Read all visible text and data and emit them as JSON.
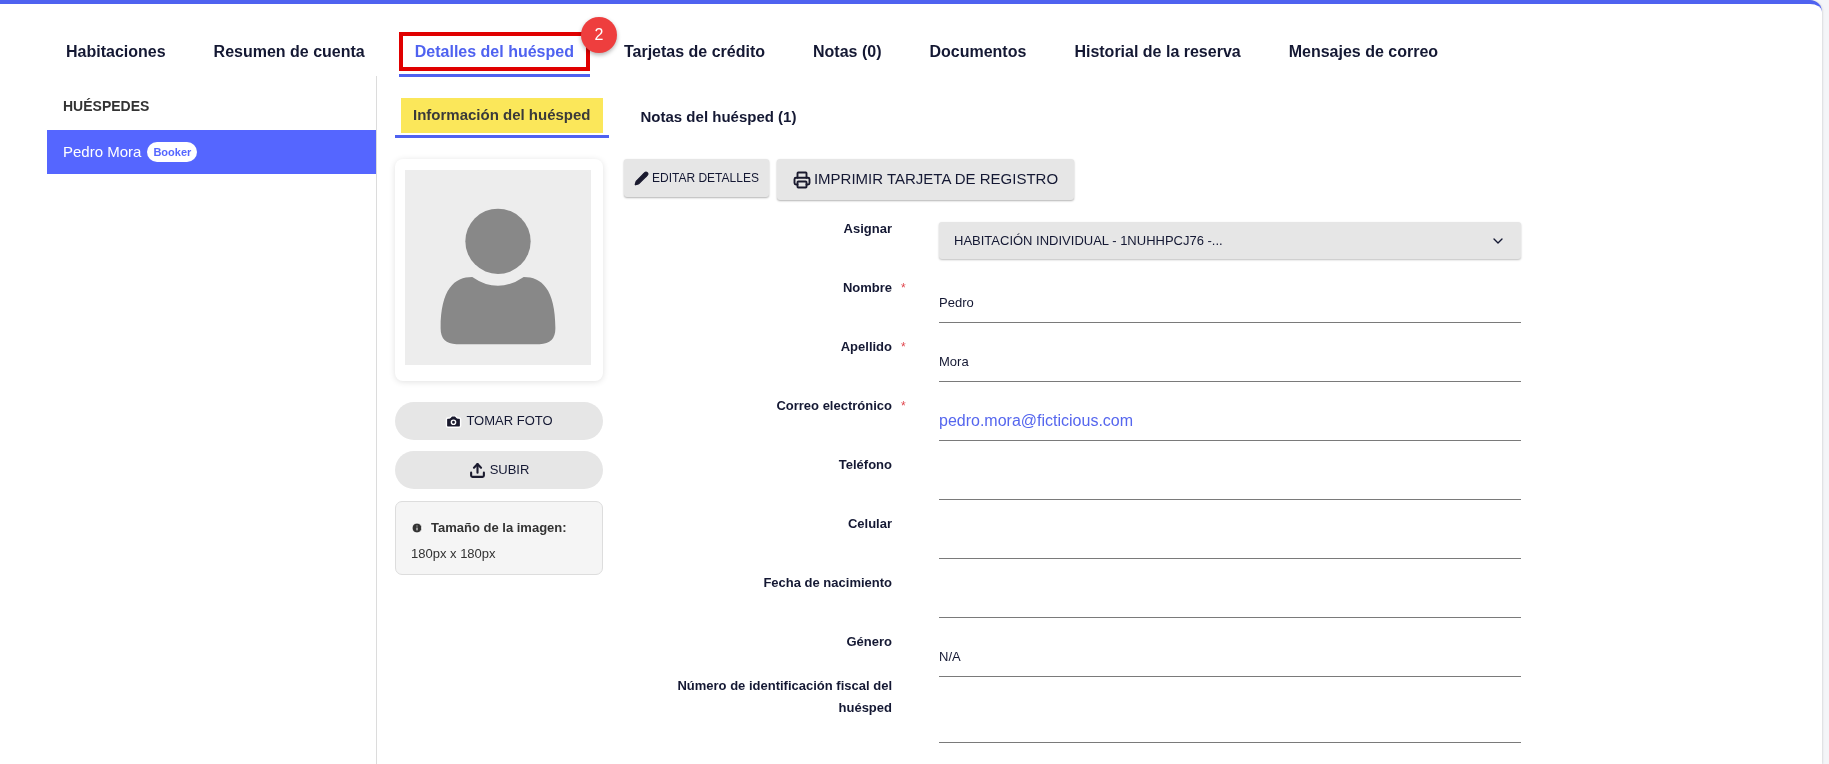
{
  "tabs": [
    {
      "label": "Habitaciones",
      "selected": false
    },
    {
      "label": "Resumen de cuenta",
      "selected": false
    },
    {
      "label": "Detalles del huésped",
      "selected": true,
      "callout": "2"
    },
    {
      "label": "Tarjetas de crédito",
      "selected": false
    },
    {
      "label": "Notas (0)",
      "selected": false
    },
    {
      "label": "Documentos",
      "selected": false
    },
    {
      "label": "Historial de la reserva",
      "selected": false
    },
    {
      "label": "Mensajes de correo",
      "selected": false
    }
  ],
  "sidebar": {
    "title": "HUÉSPEDES",
    "items": [
      {
        "name": "Pedro Mora",
        "badge": "Booker",
        "selected": true
      }
    ]
  },
  "subtabs": [
    {
      "label": "Información del huésped",
      "selected": true
    },
    {
      "label": "Notas del huésped (1)",
      "selected": false
    }
  ],
  "photo": {
    "buttons": [
      {
        "kind": "camera",
        "label": "TOMAR FOTO"
      },
      {
        "kind": "upload",
        "label": "SUBIR"
      }
    ],
    "info_title": "Tamaño de la imagen:",
    "info_text": "180px x 180px"
  },
  "actions": [
    {
      "kind": "edit",
      "label": "EDITAR DETALLES"
    },
    {
      "kind": "print",
      "label": "IMPRIMIR TARJETA DE REGISTRO"
    }
  ],
  "fields": [
    {
      "kind": "select",
      "label": "Asignar",
      "value": "HABITACIÓN INDIVIDUAL - 1NUHHPCJ76 -..."
    },
    {
      "kind": "text",
      "label": "Nombre",
      "required_mark": "*",
      "value": "Pedro"
    },
    {
      "kind": "text",
      "label": "Apellido",
      "required_mark": "*",
      "value": "Mora"
    },
    {
      "kind": "email",
      "label": "Correo electrónico",
      "required_mark": "*",
      "value": "pedro.mora@ficticious.com"
    },
    {
      "kind": "text",
      "label": "Teléfono"
    },
    {
      "kind": "text",
      "label": "Celular"
    },
    {
      "kind": "text",
      "label": "Fecha de nacimiento"
    },
    {
      "kind": "text",
      "label": "Género",
      "value": "N/A"
    },
    {
      "kind": "text",
      "label": "Número de identificación fiscal del huésped"
    }
  ]
}
